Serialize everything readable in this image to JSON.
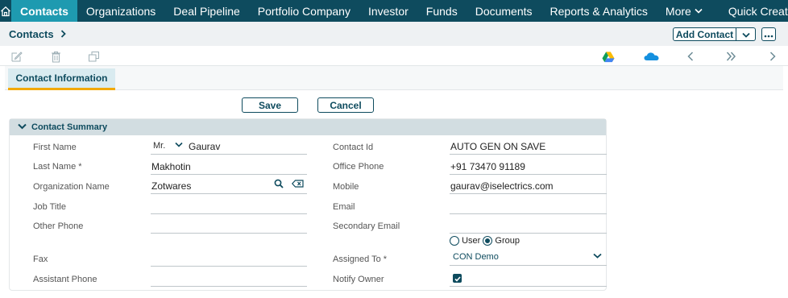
{
  "nav": {
    "items": [
      {
        "label": "Contacts",
        "active": true
      },
      {
        "label": "Organizations"
      },
      {
        "label": "Deal Pipeline"
      },
      {
        "label": "Portfolio Company"
      },
      {
        "label": "Investor"
      },
      {
        "label": "Funds"
      },
      {
        "label": "Documents"
      },
      {
        "label": "Reports & Analytics"
      },
      {
        "label": "More"
      },
      {
        "label": "Quick Create"
      }
    ]
  },
  "breadcrumb": {
    "label": "Contacts"
  },
  "header": {
    "add_button": "Add Contact"
  },
  "tab": {
    "label": "Contact Information"
  },
  "actions": {
    "save": "Save",
    "cancel": "Cancel"
  },
  "section": {
    "title": "Contact Summary"
  },
  "left_fields": {
    "first_name": {
      "label": "First Name",
      "salutation": "Mr.",
      "value": "Gaurav"
    },
    "last_name": {
      "label": "Last Name *",
      "value": "Makhotin"
    },
    "organization": {
      "label": "Organization Name",
      "value": "Zotwares"
    },
    "job_title": {
      "label": "Job Title",
      "value": ""
    },
    "other_phone": {
      "label": "Other Phone",
      "value": ""
    },
    "fax": {
      "label": "Fax",
      "value": ""
    },
    "assistant_phone": {
      "label": "Assistant Phone",
      "value": ""
    }
  },
  "right_fields": {
    "contact_id": {
      "label": "Contact Id",
      "value": "AUTO GEN ON SAVE"
    },
    "office_phone": {
      "label": "Office Phone",
      "value": "+91 73470 91189"
    },
    "mobile": {
      "label": "Mobile",
      "value": "gaurav@iselectrics.com"
    },
    "email": {
      "label": "Email",
      "value": ""
    },
    "secondary_email": {
      "label": "Secondary Email",
      "value": ""
    },
    "assign_type": {
      "option_user": "User",
      "option_group": "Group",
      "selected": "Group"
    },
    "assigned_to": {
      "label": "Assigned To *",
      "value": "CON Demo"
    },
    "notify_owner": {
      "label": "Notify Owner",
      "checked": true
    }
  },
  "colors": {
    "nav_bg": "#0e4b5e",
    "nav_active": "#1e9ab0",
    "accent": "#f2a900"
  }
}
